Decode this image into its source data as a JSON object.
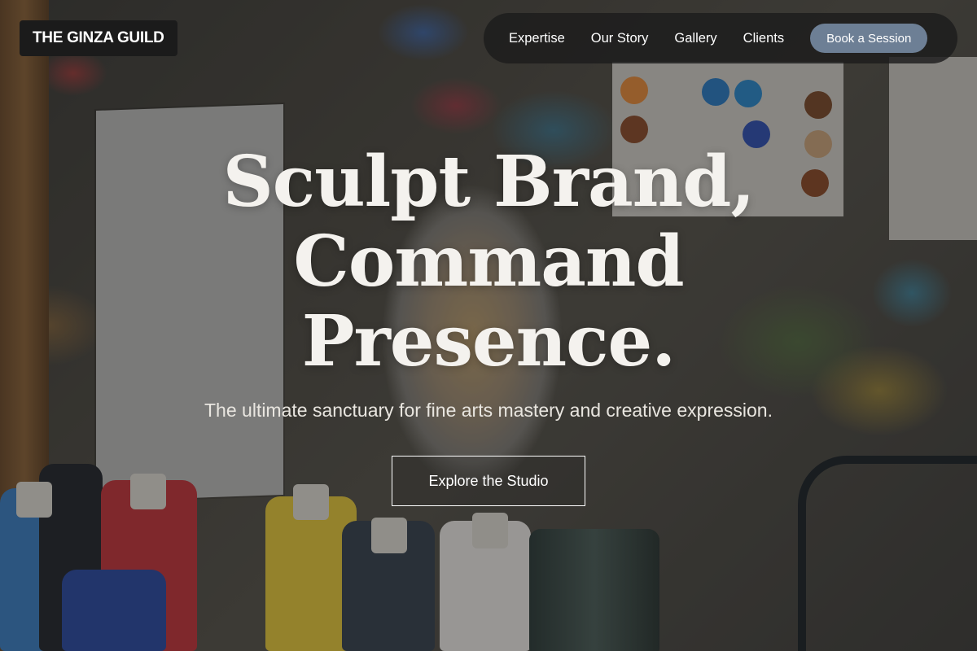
{
  "brand": {
    "name": "THE GINZA GUILD"
  },
  "nav": {
    "links": [
      {
        "label": "Expertise"
      },
      {
        "label": "Our Story"
      },
      {
        "label": "Gallery"
      },
      {
        "label": "Clients"
      }
    ],
    "cta_label": "Book a Session"
  },
  "hero": {
    "headline_lines": [
      "Sculpt Brand,",
      "Command",
      "Presence."
    ],
    "subtitle": "The ultimate sanctuary for fine arts mastery and creative expression.",
    "cta_label": "Explore the Studio",
    "background_image": "art-studio-paint-bottles-brushes"
  },
  "colors": {
    "nav_background": "#1c1c1c",
    "book_button": "#6d7f95",
    "headline_text": "#f4f2ee",
    "brand_background": "#1b1b1b"
  }
}
